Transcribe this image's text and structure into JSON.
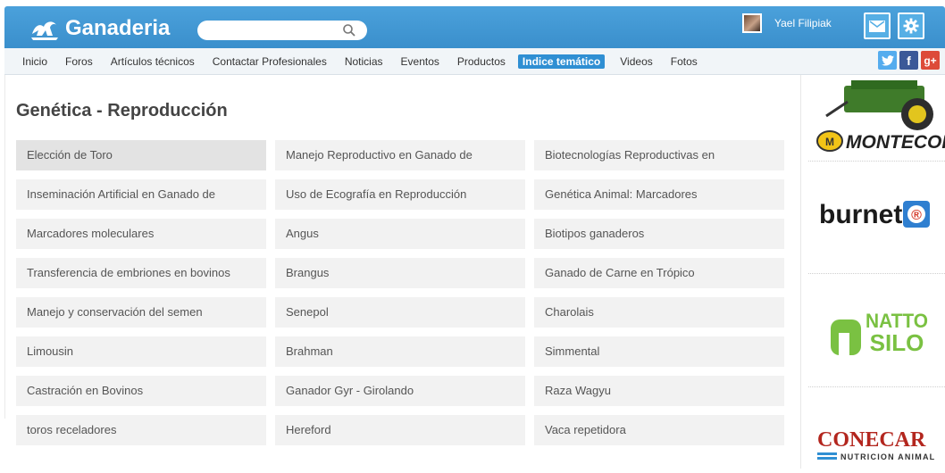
{
  "header": {
    "brand": "Ganaderia",
    "search_placeholder": "",
    "user_name": "Yael Filipiak",
    "icons": [
      "logo-icon",
      "search-icon",
      "mail-icon",
      "gear-icon"
    ]
  },
  "nav": {
    "items": [
      "Inicio",
      "Foros",
      "Artículos técnicos",
      "Contactar Profesionales",
      "Noticias",
      "Eventos",
      "Productos",
      "Indice temático",
      "Videos",
      "Fotos"
    ],
    "active": "Indice temático",
    "social": [
      {
        "name": "twitter",
        "label": "t"
      },
      {
        "name": "facebook",
        "label": "f"
      },
      {
        "name": "googleplus",
        "label": "g+"
      }
    ]
  },
  "main": {
    "title": "Genética - Reproducción",
    "tiles": [
      [
        "Elección de Toro",
        "Manejo Reproductivo en Ganado de",
        "Biotecnologías Reproductivas en"
      ],
      [
        "Inseminación Artificial en Ganado de",
        "Uso de Ecografía en Reproducción",
        "Genética Animal: Marcadores"
      ],
      [
        "Marcadores moleculares",
        "Angus",
        "Biotipos ganaderos"
      ],
      [
        "Transferencia de embriones en bovinos",
        "Brangus",
        "Ganado de Carne en Trópico"
      ],
      [
        "Manejo y conservación del semen",
        "Senepol",
        "Charolais"
      ],
      [
        "Limousin",
        "Brahman",
        "Simmental"
      ],
      [
        "Castración en Bovinos",
        "Ganador Gyr - Girolando",
        "Raza Wagyu"
      ],
      [
        "toros receladores",
        "Hereford",
        "Vaca repetidora"
      ]
    ]
  },
  "sidebar": {
    "ads": [
      {
        "brand": "MONTECOR",
        "badge": "M"
      },
      {
        "brand": "burnet",
        "badge": "®"
      },
      {
        "brand": "NATTO SILO"
      },
      {
        "brand": "CONECAR",
        "tagline": "NUTRICION ANIMAL"
      }
    ]
  },
  "colors": {
    "header_blue": "#3a8fcc",
    "active_blue": "#2f8fd3",
    "tile_bg": "#f2f2f2",
    "twitter": "#55acee",
    "facebook": "#3b5998",
    "googleplus": "#dd4b39"
  }
}
